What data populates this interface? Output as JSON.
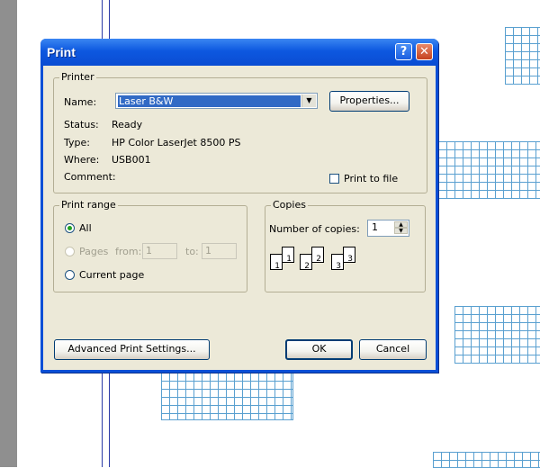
{
  "dialog": {
    "title": "Print",
    "help_glyph": "?",
    "close_glyph": "✕"
  },
  "printer": {
    "group_label": "Printer",
    "name_label": "Name:",
    "name_value": "Laser B&W",
    "properties_label": "Properties...",
    "status_label": "Status:",
    "status_value": "Ready",
    "type_label": "Type:",
    "type_value": "HP Color LaserJet 8500 PS",
    "where_label": "Where:",
    "where_value": "USB001",
    "comment_label": "Comment:",
    "comment_value": "",
    "print_to_file_label": "Print to file",
    "print_to_file_checked": false
  },
  "print_range": {
    "group_label": "Print range",
    "all_label": "All",
    "pages_label": "Pages",
    "from_label": "from:",
    "from_value": "1",
    "to_label": "to:",
    "to_value": "1",
    "current_page_label": "Current page",
    "selected": "All"
  },
  "copies": {
    "group_label": "Copies",
    "number_label": "Number of copies:",
    "number_value": "1",
    "collate_pages": [
      "1",
      "1",
      "2",
      "2",
      "3",
      "3"
    ]
  },
  "footer": {
    "advanced_label": "Advanced Print Settings...",
    "ok_label": "OK",
    "cancel_label": "Cancel"
  },
  "colors": {
    "titlebar": "#0d58e0",
    "dialog_face": "#ece9d8",
    "grid_line": "#5aa0d0"
  }
}
